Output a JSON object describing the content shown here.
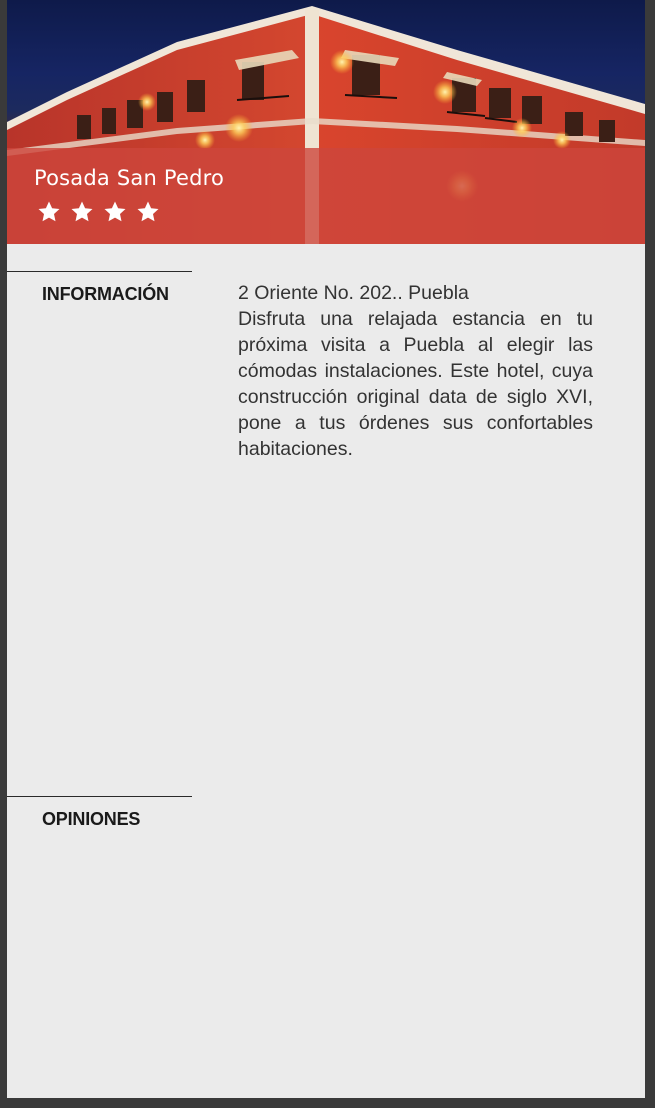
{
  "hotel": {
    "name": "Posada San Pedro",
    "stars": 4
  },
  "nav": {
    "info_label": "INFORMACIÓN",
    "opinions_label": "OPINIONES"
  },
  "info": {
    "address": "2 Oriente No. 202.. Puebla",
    "description": "Disfruta una relajada estancia en tu próxima visita a Puebla al elegir las cómodas instalaciones.   Este hotel, cuya construcción   original data de siglo XVI, pone  a tus  órdenes  sus confortables habitaciones."
  },
  "icons": {
    "star": "star-icon"
  },
  "colors": {
    "banner": "#cd463c",
    "panel_background": "#ebebeb",
    "outer_background": "#3a3a3a",
    "body_text": "#333333"
  }
}
